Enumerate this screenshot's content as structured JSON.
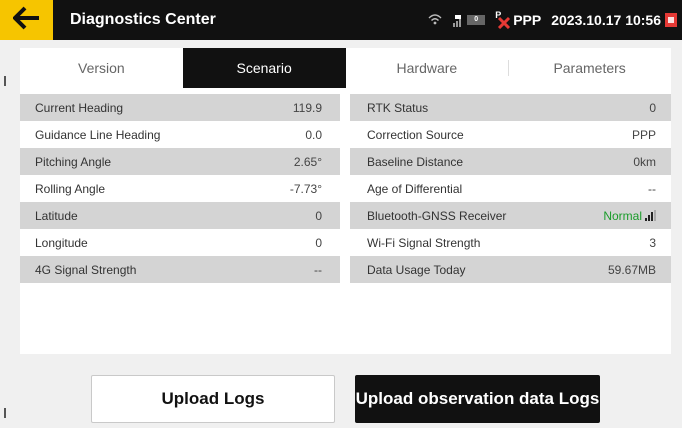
{
  "header": {
    "title": "Diagnostics Center",
    "network_mode": "PPP",
    "satellite_badge": "0",
    "ppp_icon_letter": "P",
    "datetime": "2023.10.17 10:56"
  },
  "tabs": [
    {
      "label": "Version",
      "active": false
    },
    {
      "label": "Scenario",
      "active": true
    },
    {
      "label": "Hardware",
      "active": false
    },
    {
      "label": "Parameters",
      "active": false
    }
  ],
  "left_rows": [
    {
      "label": "Current Heading",
      "value": "119.9"
    },
    {
      "label": "Guidance Line Heading",
      "value": "0.0"
    },
    {
      "label": "Pitching Angle",
      "value": "2.65°"
    },
    {
      "label": "Rolling Angle",
      "value": "-7.73°"
    },
    {
      "label": "Latitude",
      "value": "0"
    },
    {
      "label": "Longitude",
      "value": "0"
    },
    {
      "label": "4G Signal Strength",
      "value": "--"
    }
  ],
  "right_rows": [
    {
      "label": "RTK Status",
      "value": "0"
    },
    {
      "label": "Correction Source",
      "value": "PPP"
    },
    {
      "label": "Baseline Distance",
      "value": "0km"
    },
    {
      "label": "Age of Differential",
      "value": "--"
    },
    {
      "label": "Bluetooth-GNSS Receiver",
      "value": "Normal"
    },
    {
      "label": "Wi-Fi Signal Strength",
      "value": "3"
    },
    {
      "label": "Data Usage Today",
      "value": "59.67MB"
    }
  ],
  "buttons": {
    "upload_logs": "Upload Logs",
    "upload_observation_logs": "Upload observation data Logs"
  },
  "colors": {
    "accent": "#f6c500",
    "topbar": "#111111",
    "status_ok": "#1a9c2a",
    "row_shade": "#d4d4d4"
  }
}
